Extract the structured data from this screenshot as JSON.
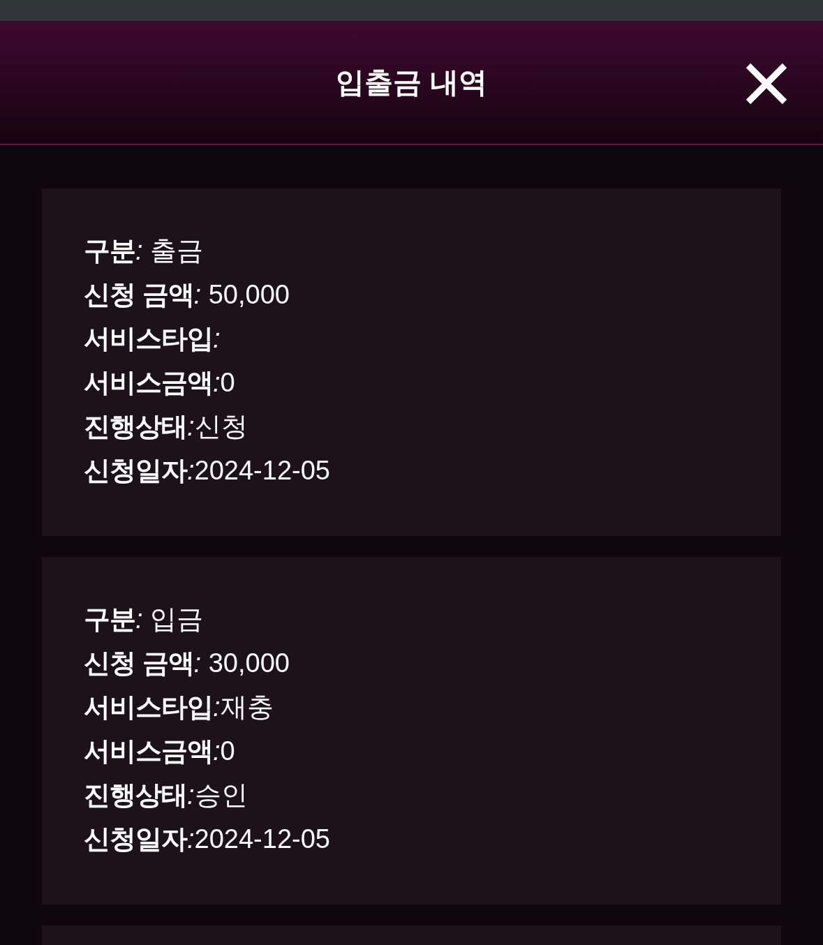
{
  "header": {
    "title": "입출금 내역"
  },
  "records": [
    {
      "kind": "record",
      "rows": [
        {
          "label": "구분",
          "separator": ": ",
          "value": "출금"
        },
        {
          "label": "신청 금액",
          "separator": ": ",
          "value": "50,000"
        },
        {
          "label": "서비스타입",
          "separator": ":"
        },
        {
          "label": "서비스금액",
          "separator": ":",
          "value": "0"
        },
        {
          "label": "진행상태",
          "separator": ":",
          "value": "신청"
        },
        {
          "label": "신청일자",
          "separator": ":",
          "value": "2024-12-05"
        }
      ]
    },
    {
      "kind": "record",
      "rows": [
        {
          "label": "구분",
          "separator": ": ",
          "value": "입금"
        },
        {
          "label": "신청 금액",
          "separator": ": ",
          "value": "30,000"
        },
        {
          "label": "서비스타입",
          "separator": ":",
          "value": "재충"
        },
        {
          "label": "서비스금액",
          "separator": ":",
          "value": "0"
        },
        {
          "label": "진행상태",
          "separator": ":",
          "value": "승인"
        },
        {
          "label": "신청일자",
          "separator": ":",
          "value": "2024-12-05"
        }
      ]
    },
    {
      "kind": "record"
    }
  ]
}
